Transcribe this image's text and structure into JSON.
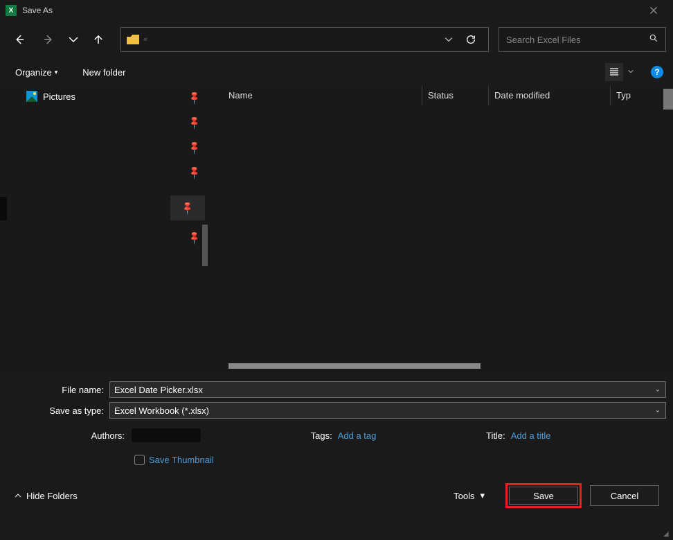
{
  "window": {
    "title": "Save As"
  },
  "nav": {
    "breadcrumb_sep": "«"
  },
  "search": {
    "placeholder": "Search Excel Files"
  },
  "toolbar": {
    "organize": "Organize",
    "new_folder": "New folder"
  },
  "sidebar": {
    "pictures": "Pictures"
  },
  "columns": {
    "name": "Name",
    "status": "Status",
    "date": "Date modified",
    "type": "Typ"
  },
  "form": {
    "file_name_label": "File name:",
    "file_name_value": "Excel Date Picker.xlsx",
    "save_type_label": "Save as type:",
    "save_type_value": "Excel Workbook (*.xlsx)",
    "authors_label": "Authors:",
    "tags_label": "Tags:",
    "tags_link": "Add a tag",
    "title_label": "Title:",
    "title_link": "Add a title",
    "thumbnail_label": "Save Thumbnail"
  },
  "actions": {
    "hide_folders": "Hide Folders",
    "tools": "Tools",
    "save": "Save",
    "cancel": "Cancel"
  },
  "help_text": "?"
}
